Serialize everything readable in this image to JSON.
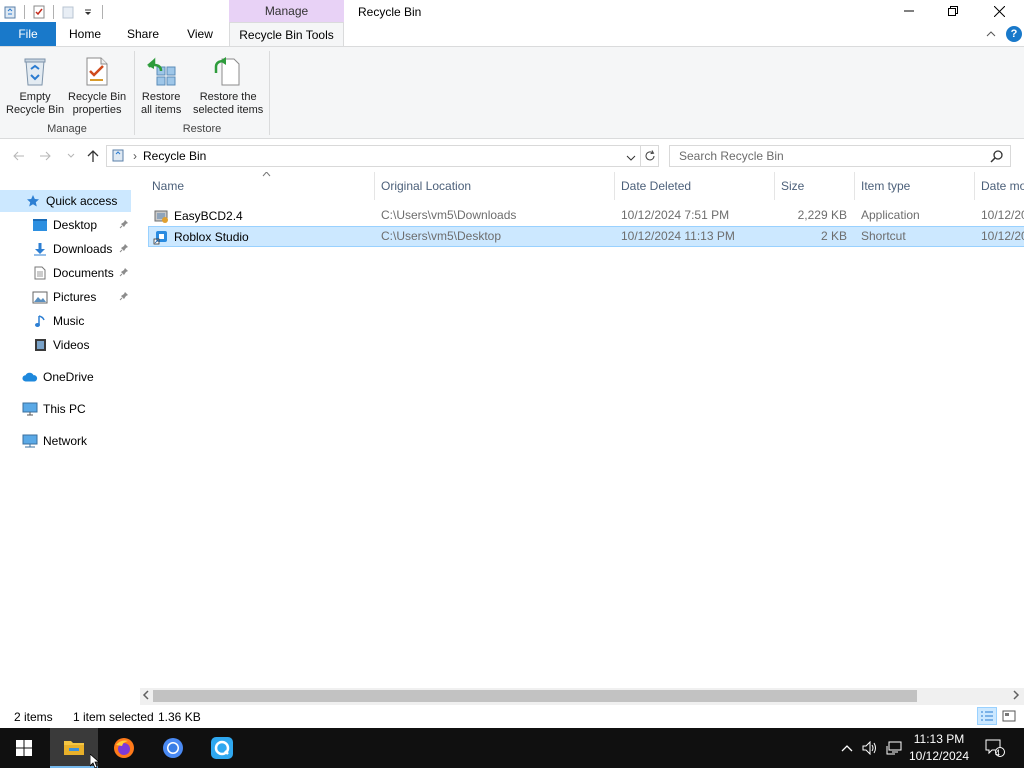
{
  "window": {
    "title": "Recycle Bin",
    "context_tab_header": "Manage"
  },
  "ribbon": {
    "tabs": {
      "file": "File",
      "home": "Home",
      "share": "Share",
      "view": "View",
      "recycle_bin_tools": "Recycle Bin Tools"
    },
    "groups": {
      "manage": {
        "label": "Manage",
        "empty_line1": "Empty",
        "empty_line2": "Recycle Bin",
        "props_line1": "Recycle Bin",
        "props_line2": "properties"
      },
      "restore": {
        "label": "Restore",
        "all_line1": "Restore",
        "all_line2": "all items",
        "sel_line1": "Restore the",
        "sel_line2": "selected items"
      }
    },
    "help_label": "?"
  },
  "address": {
    "path": "Recycle Bin",
    "separator": "›",
    "search_placeholder": "Search Recycle Bin"
  },
  "nav": {
    "quick_access": "Quick access",
    "items": [
      {
        "label": "Desktop",
        "pinned": true
      },
      {
        "label": "Downloads",
        "pinned": true
      },
      {
        "label": "Documents",
        "pinned": true
      },
      {
        "label": "Pictures",
        "pinned": true
      },
      {
        "label": "Music",
        "pinned": false
      },
      {
        "label": "Videos",
        "pinned": false
      }
    ],
    "onedrive": "OneDrive",
    "this_pc": "This PC",
    "network": "Network"
  },
  "columns": {
    "name": "Name",
    "original_location": "Original Location",
    "date_deleted": "Date Deleted",
    "size": "Size",
    "item_type": "Item type",
    "date_modified": "Date mo"
  },
  "files": [
    {
      "name": "EasyBCD2.4",
      "original_location": "C:\\Users\\vm5\\Downloads",
      "date_deleted": "10/12/2024 7:51 PM",
      "size": "2,229 KB",
      "item_type": "Application",
      "date_modified": "10/12/20",
      "selected": false
    },
    {
      "name": "Roblox Studio",
      "original_location": "C:\\Users\\vm5\\Desktop",
      "date_deleted": "10/12/2024 11:13 PM",
      "size": "2 KB",
      "item_type": "Shortcut",
      "date_modified": "10/12/20",
      "selected": true
    }
  ],
  "status": {
    "item_count": "2 items",
    "selection": "1 item selected",
    "selection_size": "1.36 KB"
  },
  "taskbar": {
    "clock_time": "11:13 PM",
    "clock_date": "10/12/2024",
    "notification_count": "4"
  },
  "colors": {
    "accent": "#1979ca",
    "context_tab": "#e8d2f6",
    "selection": "#cce8ff",
    "selection_border": "#99d1ff"
  }
}
